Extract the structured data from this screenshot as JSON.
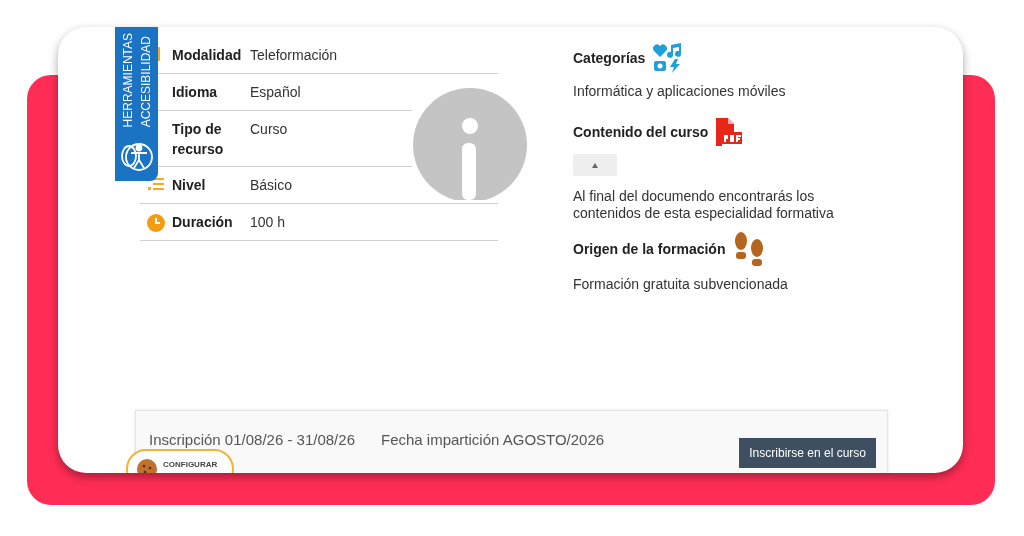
{
  "accessibility_tab": {
    "lines": [
      "HERRAMIENTAS",
      "ACCESIBILIDAD"
    ]
  },
  "details": [
    {
      "kind": "modality",
      "label": "Modalidad",
      "value": "Teleformación"
    },
    {
      "kind": "language",
      "label": "Idioma",
      "value": "Español"
    },
    {
      "kind": "resource",
      "label": "Tipo de recurso",
      "value": "Curso"
    },
    {
      "kind": "level",
      "label": "Nivel",
      "value": "Básico"
    },
    {
      "kind": "duration",
      "label": "Duración",
      "value": "100 h"
    }
  ],
  "info": [
    {
      "kind": "categories",
      "title": "Categorías",
      "text": "Informática y aplicaciones móviles"
    },
    {
      "kind": "content",
      "title": "Contenido del curso",
      "text": "Al final del documendo encontrarás los contenidos de esta especialidad formativa"
    },
    {
      "kind": "origin",
      "title": "Origen de la formación",
      "text": "Formación gratuita subvencionada"
    }
  ],
  "enrollment": {
    "registration": "Inscripción 01/08/26 - 31/08/26",
    "dates": "Fecha impartición AGOSTO/2026",
    "button": "Inscribirse en el curso"
  },
  "cookies_button": {
    "label": "CONFIGURAR"
  }
}
